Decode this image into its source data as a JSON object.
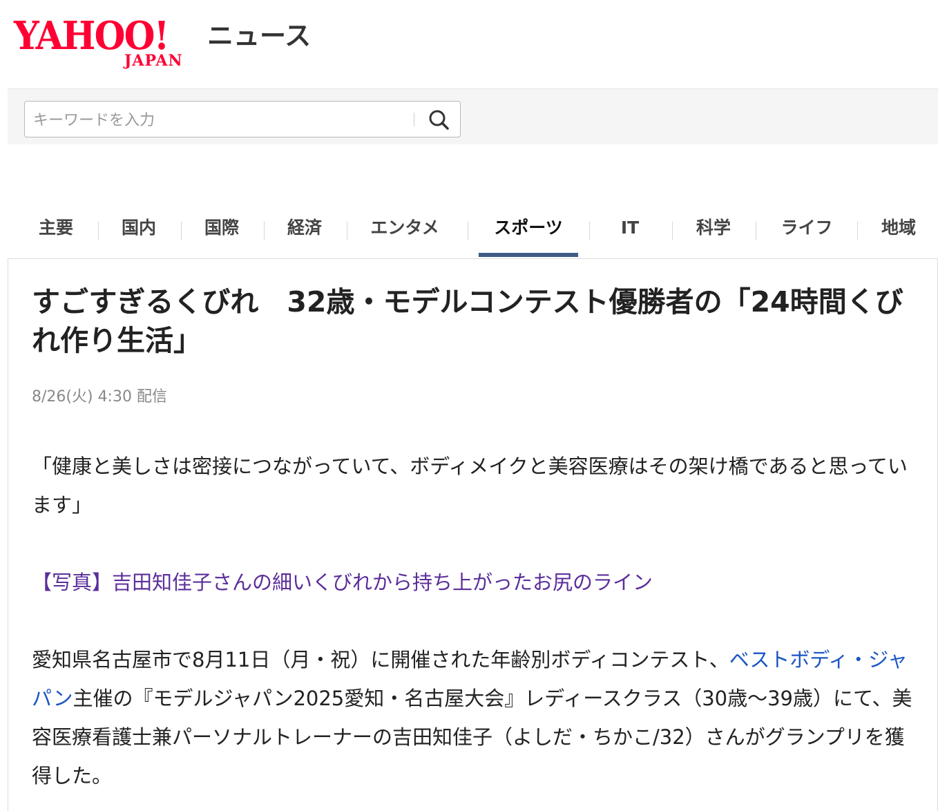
{
  "header": {
    "logo_text": "YAHOO!",
    "logo_sub": "JAPAN",
    "service_name": "ニュース"
  },
  "search": {
    "placeholder": "キーワードを入力",
    "value": ""
  },
  "nav": {
    "tabs": [
      {
        "label": "主要"
      },
      {
        "label": "国内"
      },
      {
        "label": "国際"
      },
      {
        "label": "経済"
      },
      {
        "label": "エンタメ"
      },
      {
        "label": "スポーツ",
        "active": true
      },
      {
        "label": "IT"
      },
      {
        "label": "科学"
      },
      {
        "label": "ライフ"
      },
      {
        "label": "地域"
      }
    ]
  },
  "article": {
    "title": "すごすぎるくびれ　32歳・モデルコンテスト優勝者の「24時間くびれ作り生活」",
    "date": "8/26(火) 4:30 配信",
    "paragraph1": "「健康と美しさは密接につながっていて、ボディメイクと美容医療はその架け橋であると思っています」",
    "photo_link": "【写真】吉田知佳子さんの細いくびれから持ち上がったお尻のライン",
    "paragraph2_before": "愛知県名古屋市で8月11日（月・祝）に開催された年齢別ボディコンテスト、",
    "paragraph2_link": "ベストボディ・ジャパン",
    "paragraph2_after": "主催の『モデルジャパン2025愛知・名古屋大会』レディースクラス（30歳〜39歳）にて、美容医療看護士兼パーソナルトレーナーの吉田知佳子（よしだ・ちかこ/32）さんがグランプリを獲得した。"
  },
  "colors": {
    "brand": "#ff0033",
    "tab_active_underline": "#3f5a85",
    "visited_link": "#5b2e9a",
    "link": "#1a55c4"
  }
}
